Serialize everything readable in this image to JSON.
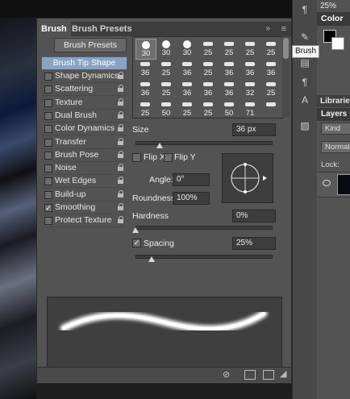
{
  "zoom": "25%",
  "panel": {
    "tabs": [
      "Brush",
      "Brush Presets"
    ],
    "collapse_icon": "double-chevron-right",
    "menu_icon": "hamburger",
    "presets_button": "Brush Presets",
    "options": [
      {
        "label": "Brush Tip Shape",
        "checked": null,
        "selected": true
      },
      {
        "label": "Shape Dynamics",
        "checked": false
      },
      {
        "label": "Scattering",
        "checked": false
      },
      {
        "label": "Texture",
        "checked": false
      },
      {
        "label": "Dual Brush",
        "checked": false
      },
      {
        "label": "Color Dynamics",
        "checked": false
      },
      {
        "label": "Transfer",
        "checked": false
      },
      {
        "label": "Brush Pose",
        "checked": false
      },
      {
        "label": "Noise",
        "checked": false
      },
      {
        "label": "Wet Edges",
        "checked": false
      },
      {
        "label": "Build-up",
        "checked": false
      },
      {
        "label": "Smoothing",
        "checked": true
      },
      {
        "label": "Protect Texture",
        "checked": false
      }
    ],
    "tip_grid_numbers": [
      [
        "30",
        "30",
        "30",
        "25",
        "25",
        "25",
        "25"
      ],
      [
        "36",
        "25",
        "36",
        "25",
        "36",
        "36",
        "36"
      ],
      [
        "36",
        "25",
        "36",
        "36",
        "36",
        "32",
        "25"
      ],
      [
        "25",
        "50",
        "25",
        "25",
        "50",
        "71",
        ""
      ]
    ],
    "size_label": "Size",
    "size_value": "36 px",
    "size_slider_pct": 18,
    "flip_x_label": "Flip X",
    "flip_y_label": "Flip Y",
    "angle_label": "Angle:",
    "angle_value": "0°",
    "roundness_label": "Roundness:",
    "roundness_value": "100%",
    "hardness_label": "Hardness",
    "hardness_value": "0%",
    "hardness_slider_pct": 0,
    "spacing_label": "Spacing",
    "spacing_checked": true,
    "spacing_value": "25%",
    "spacing_slider_pct": 12
  },
  "right": {
    "color_tab": "Color",
    "tooltip": "Brush",
    "libraries_tab": "Libraries",
    "layers_tab": "Layers",
    "kind_placeholder": "Kind",
    "blend_mode": "Normal",
    "lock_label": "Lock:"
  }
}
